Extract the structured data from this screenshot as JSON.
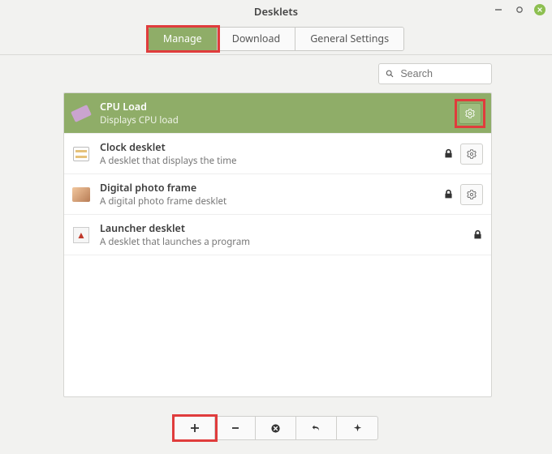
{
  "window": {
    "title": "Desklets"
  },
  "tabs": {
    "items": [
      {
        "label": "Manage",
        "active": true
      },
      {
        "label": "Download",
        "active": false
      },
      {
        "label": "General Settings",
        "active": false
      }
    ]
  },
  "search": {
    "placeholder": "Search",
    "value": ""
  },
  "desklets": [
    {
      "title": "CPU Load",
      "subtitle": "Displays CPU load",
      "selected": true,
      "locked": false,
      "settings": true,
      "icon": "cpu"
    },
    {
      "title": "Clock desklet",
      "subtitle": "A desklet that displays the time",
      "selected": false,
      "locked": true,
      "settings": true,
      "icon": "clock"
    },
    {
      "title": "Digital photo frame",
      "subtitle": "A digital photo frame desklet",
      "selected": false,
      "locked": true,
      "settings": true,
      "icon": "photo"
    },
    {
      "title": "Launcher desklet",
      "subtitle": "A desklet that launches a program",
      "selected": false,
      "locked": true,
      "settings": false,
      "icon": "launcher"
    }
  ],
  "toolbar": {
    "buttons": [
      "add",
      "remove",
      "delete",
      "undo",
      "upgrade"
    ]
  },
  "highlights": {
    "tab_manage": true,
    "row0_gear": true,
    "toolbar_add": true
  }
}
